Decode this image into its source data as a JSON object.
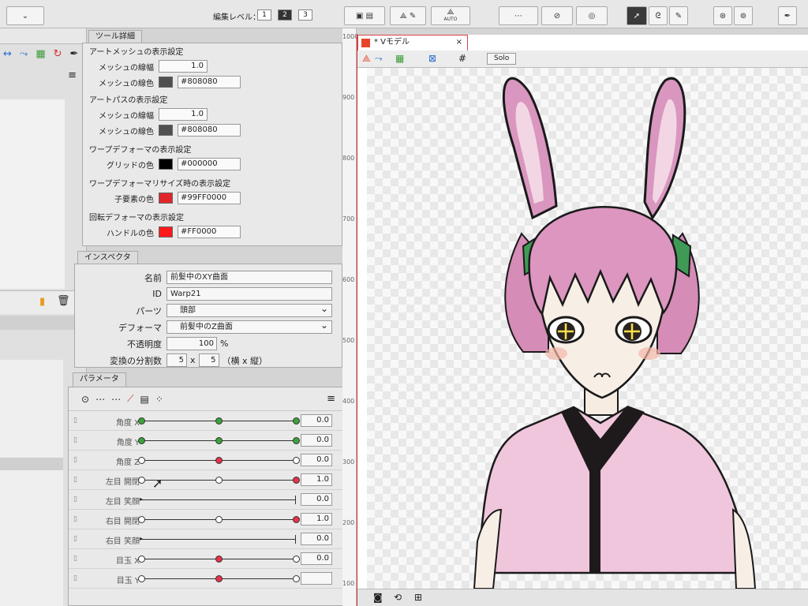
{
  "toolbar": {
    "edit_level_label": "編集レベル：",
    "levels": [
      "1",
      "2",
      "3"
    ],
    "auto_label": "AUTO"
  },
  "tool_detail": {
    "tab": "ツール詳細",
    "art_mesh_title": "アートメッシュの表示設定",
    "mesh_width_label": "メッシュの線幅",
    "mesh_width_value": "1.0",
    "mesh_color_label": "メッシュの線色",
    "mesh_color_value": "#808080",
    "art_path_title": "アートパスの表示設定",
    "path_width_label": "メッシュの線幅",
    "path_width_value": "1.0",
    "path_color_label": "メッシュの線色",
    "path_color_value": "#808080",
    "warp_title": "ワープデフォーマの表示設定",
    "grid_color_label": "グリッドの色",
    "grid_color_value": "#000000",
    "warp_resize_title": "ワープデフォーマリサイズ時の表示設定",
    "child_color_label": "子要素の色",
    "child_color_value": "#99FF0000",
    "rotation_title": "回転デフォーマの表示設定",
    "handle_color_label": "ハンドルの色",
    "handle_color_value": "#FF0000"
  },
  "inspector": {
    "tab": "インスペクタ",
    "name_label": "名前",
    "name_value": "前髪中のXY曲面",
    "id_label": "ID",
    "id_value": "Warp21",
    "parts_label": "パーツ",
    "parts_value": "頭部",
    "deformer_label": "デフォーマ",
    "deformer_value": "前髪中のZ曲面",
    "opacity_label": "不透明度",
    "opacity_value": "100",
    "opacity_unit": "%",
    "division_label": "変換の分割数",
    "division_x": "5",
    "division_sep": "x",
    "division_y": "5",
    "division_note": "（横 x 縦）"
  },
  "parameters": {
    "tab": "パラメータ",
    "rows": [
      {
        "label": "角度 X",
        "value": "0.0",
        "level": 0.5
      },
      {
        "label": "角度 Y",
        "value": "0.0",
        "level": 0.5
      },
      {
        "label": "角度 Z",
        "value": "0.0",
        "level": 0.5
      },
      {
        "label": "左目 開閉",
        "value": "1.0",
        "level": 1.0
      },
      {
        "label": "左目 笑顔",
        "value": "0.0",
        "level": 0.0
      },
      {
        "label": "右目 開閉",
        "value": "1.0",
        "level": 1.0
      },
      {
        "label": "右目 笑顔",
        "value": "0.0",
        "level": 0.0
      },
      {
        "label": "目玉 X",
        "value": "0.0",
        "level": 0.5
      },
      {
        "label": "目玉 Y",
        "value": "",
        "level": 0.5
      }
    ]
  },
  "document": {
    "tab_title": "* Vモデル",
    "close_label": "×",
    "solo_label": "Solo"
  },
  "ruler": {
    "ticks": [
      "1000",
      "900",
      "800",
      "700",
      "600",
      "500",
      "400",
      "300",
      "200",
      "100"
    ]
  },
  "colors": {
    "accent": "#e8442a",
    "swatch_gray": "#808080",
    "swatch_black": "#000000",
    "swatch_red": "#ff0000",
    "hair": "#d88fb8",
    "shirt": "#f0c8dc"
  }
}
